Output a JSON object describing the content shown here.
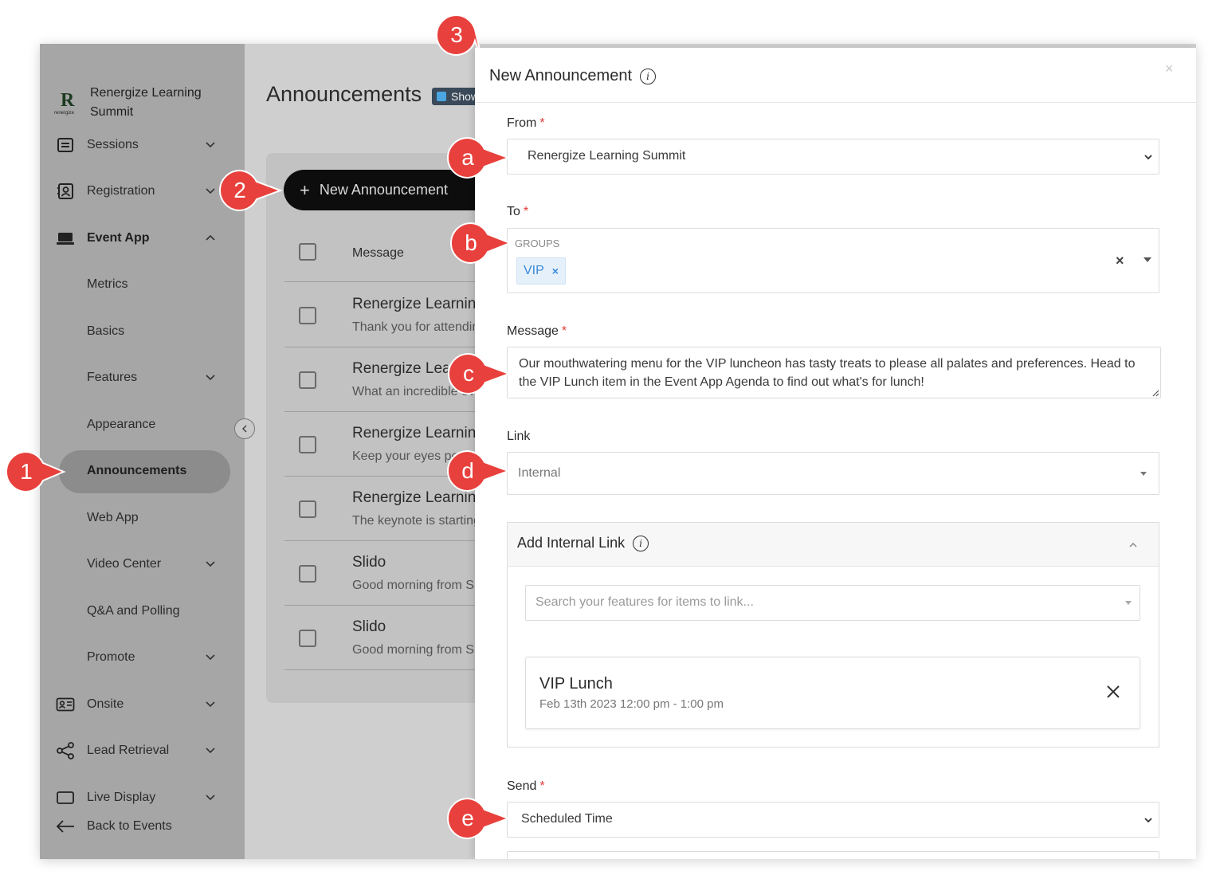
{
  "sidebar": {
    "brand": "Renergize Learning Summit",
    "logo_letter": "R",
    "logo_caption": "renergize",
    "items": [
      {
        "label": "Sessions",
        "icon": "list-icon",
        "chevron": "down"
      },
      {
        "label": "Registration",
        "icon": "contact-book-icon",
        "chevron": "down"
      },
      {
        "label": "Event App",
        "icon": "laptop-icon",
        "chevron": "up"
      },
      {
        "label": "Metrics"
      },
      {
        "label": "Basics"
      },
      {
        "label": "Features",
        "chevron": "down"
      },
      {
        "label": "Appearance"
      },
      {
        "label": "Announcements",
        "active": true
      },
      {
        "label": "Web App"
      },
      {
        "label": "Video Center",
        "chevron": "down"
      },
      {
        "label": "Q&A and Polling"
      },
      {
        "label": "Promote",
        "chevron": "down"
      },
      {
        "label": "Onsite",
        "icon": "id-card-icon",
        "chevron": "down"
      },
      {
        "label": "Lead Retrieval",
        "icon": "share-icon",
        "chevron": "down"
      },
      {
        "label": "Live Display",
        "icon": "monitor-icon",
        "chevron": "down"
      }
    ],
    "back_label": "Back to Events"
  },
  "main": {
    "title": "Announcements",
    "show_badge": "Show",
    "new_button": "New Announcement",
    "column_message": "Message",
    "rows": [
      {
        "title": "Renergize Learning Summit",
        "sub": "Thank you for attending"
      },
      {
        "title": "Renergize Learning Summit",
        "sub": "What an incredible event"
      },
      {
        "title": "Renergize Learning Summit",
        "sub": "Keep your eyes peeled"
      },
      {
        "title": "Renergize Learning Summit",
        "sub": "The keynote is starting"
      },
      {
        "title": "Slido",
        "sub": "Good morning from Slido"
      },
      {
        "title": "Slido",
        "sub": "Good morning from Slido"
      }
    ]
  },
  "modal": {
    "title": "New Announcement",
    "close": "×",
    "from": {
      "label": "From",
      "value": "Renergize Learning Summit"
    },
    "to": {
      "label": "To",
      "group_header": "GROUPS",
      "chip": "VIP",
      "chip_remove": "×",
      "clear": "×"
    },
    "message": {
      "label": "Message",
      "value": "Our mouthwatering menu for the VIP luncheon has tasty treats to please all palates and preferences. Head to the VIP Lunch item in the Event App Agenda to find out what's for lunch!"
    },
    "link": {
      "label": "Link",
      "value": "Internal"
    },
    "internal_link": {
      "title": "Add Internal Link",
      "search_placeholder": "Search your features for items to link...",
      "item_title": "VIP Lunch",
      "item_time": "Feb 13th 2023 12:00 pm - 1:00 pm"
    },
    "send": {
      "label": "Send",
      "value": "Scheduled Time"
    }
  },
  "callouts": [
    "1",
    "2",
    "3",
    "a",
    "b",
    "c",
    "d",
    "e"
  ],
  "colors": {
    "callout": "#e8403c",
    "required": "#e53935",
    "chip_text": "#3b8ad8",
    "chip_bg": "#e5f0fb"
  }
}
